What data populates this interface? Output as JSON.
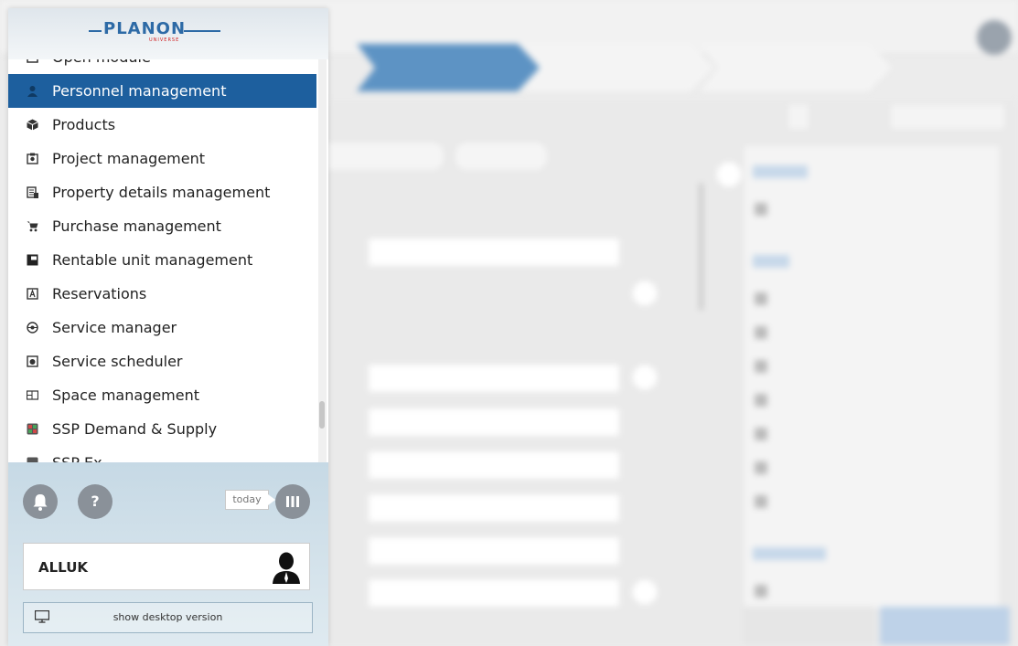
{
  "logo": {
    "text": "PLANON",
    "subtext": "UNIVERSE"
  },
  "menu": {
    "items": [
      {
        "label": "Open module",
        "icon": "window-icon"
      },
      {
        "label": "Personnel management",
        "icon": "person-icon",
        "active": true
      },
      {
        "label": "Products",
        "icon": "box-icon"
      },
      {
        "label": "Project management",
        "icon": "project-icon"
      },
      {
        "label": "Property details management",
        "icon": "property-icon"
      },
      {
        "label": "Purchase management",
        "icon": "cart-icon"
      },
      {
        "label": "Rentable unit management",
        "icon": "rentable-unit-icon"
      },
      {
        "label": "Reservations",
        "icon": "reservation-icon"
      },
      {
        "label": "Service manager",
        "icon": "service-manager-icon"
      },
      {
        "label": "Service scheduler",
        "icon": "scheduler-icon"
      },
      {
        "label": "Space management",
        "icon": "space-icon"
      },
      {
        "label": "SSP Demand & Supply",
        "icon": "demand-supply-icon"
      },
      {
        "label": "SSP Ex...",
        "icon": "ssp-icon"
      }
    ]
  },
  "footer": {
    "today_label": "today",
    "username": "ALLUK",
    "desktop_label": "show desktop version"
  },
  "colors": {
    "accent": "#1d5f9e",
    "header": "#2d6aa6"
  }
}
